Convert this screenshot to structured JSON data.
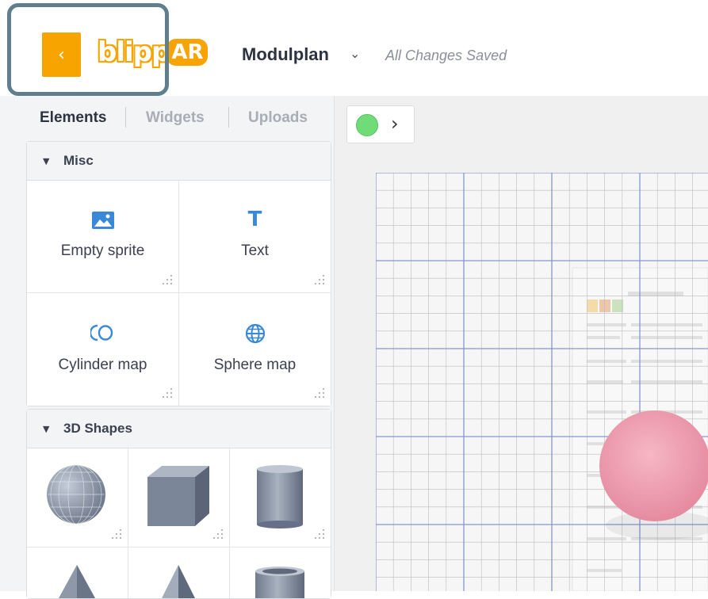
{
  "header": {
    "back_label": "‹",
    "logo_text": "blipp",
    "logo_ar": "AR",
    "project_name": "Modulplan",
    "project_chevron": "⌄",
    "save_status": "All Changes Saved"
  },
  "sidebar": {
    "tabs": [
      {
        "label": "Elements",
        "active": true
      },
      {
        "label": "Widgets",
        "active": false
      },
      {
        "label": "Uploads",
        "active": false
      }
    ],
    "misc": {
      "title": "Misc",
      "items": [
        {
          "label": "Empty sprite",
          "icon": "image-icon"
        },
        {
          "label": "Text",
          "icon": "text-icon"
        },
        {
          "label": "Cylinder map",
          "icon": "cylinder-map-icon"
        },
        {
          "label": "Sphere map",
          "icon": "globe-icon"
        }
      ]
    },
    "shapes": {
      "title": "3D Shapes",
      "items": [
        "sphere-shape",
        "cube-shape",
        "cylinder-shape",
        "cone-shape",
        "pyramid-shape",
        "tube-shape"
      ]
    }
  },
  "canvas": {
    "status_color": "#6fdc78",
    "expand_icon": "›",
    "sphere_color": "#f2a7b7"
  },
  "colors": {
    "brand": "#f7a400",
    "accent": "#3a88d8"
  }
}
